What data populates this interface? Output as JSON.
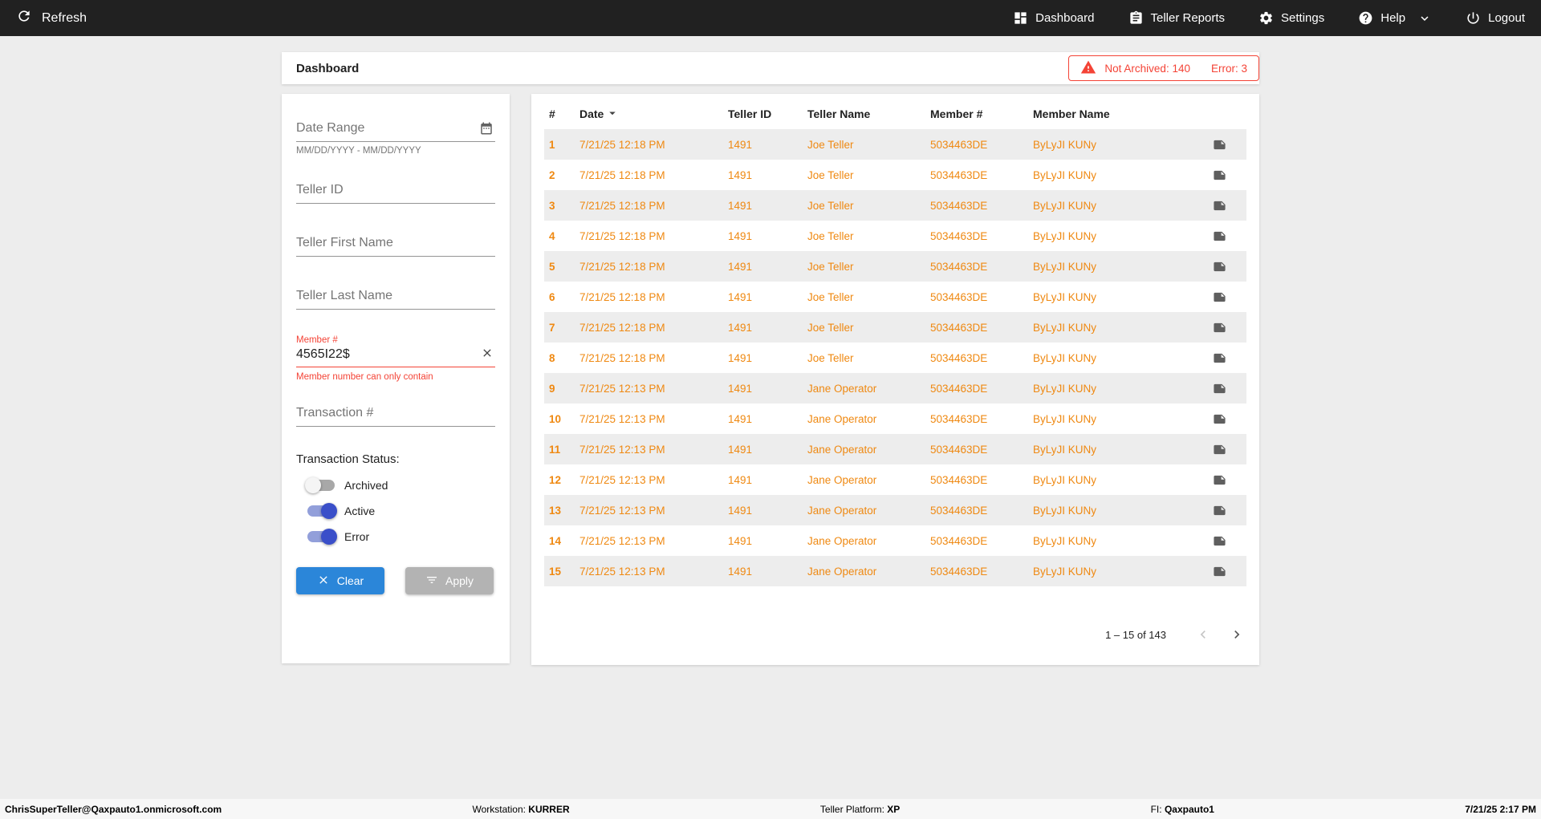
{
  "topbar": {
    "refresh_label": "Refresh",
    "nav": [
      {
        "label": "Dashboard"
      },
      {
        "label": "Teller Reports"
      },
      {
        "label": "Settings"
      },
      {
        "label": "Help"
      },
      {
        "label": "Logout"
      }
    ]
  },
  "header": {
    "title": "Dashboard",
    "alert": {
      "not_archived": "Not Archived: 140",
      "error": "Error: 3"
    }
  },
  "filters": {
    "date_range": {
      "placeholder": "Date Range",
      "helper": "MM/DD/YYYY - MM/DD/YYYY"
    },
    "teller_id": {
      "placeholder": "Teller ID"
    },
    "teller_first_name": {
      "placeholder": "Teller First Name"
    },
    "teller_last_name": {
      "placeholder": "Teller Last Name"
    },
    "member_number": {
      "label": "Member #",
      "value": "4565I22$",
      "error": "Member number can only contain"
    },
    "transaction_number": {
      "placeholder": "Transaction #"
    },
    "status": {
      "label": "Transaction Status:",
      "toggles": [
        {
          "label": "Archived",
          "on": false
        },
        {
          "label": "Active",
          "on": true
        },
        {
          "label": "Error",
          "on": true
        }
      ]
    },
    "clear_label": "Clear",
    "apply_label": "Apply"
  },
  "table": {
    "columns": [
      "#",
      "Date",
      "Teller ID",
      "Teller Name",
      "Member #",
      "Member Name"
    ],
    "rows": [
      {
        "num": "1",
        "date": "7/21/25 12:18 PM",
        "teller_id": "1491",
        "teller_name": "Joe Teller",
        "member_num": "5034463DE",
        "member_name": "ByLyJI KUNy"
      },
      {
        "num": "2",
        "date": "7/21/25 12:18 PM",
        "teller_id": "1491",
        "teller_name": "Joe Teller",
        "member_num": "5034463DE",
        "member_name": "ByLyJI KUNy"
      },
      {
        "num": "3",
        "date": "7/21/25 12:18 PM",
        "teller_id": "1491",
        "teller_name": "Joe Teller",
        "member_num": "5034463DE",
        "member_name": "ByLyJI KUNy"
      },
      {
        "num": "4",
        "date": "7/21/25 12:18 PM",
        "teller_id": "1491",
        "teller_name": "Joe Teller",
        "member_num": "5034463DE",
        "member_name": "ByLyJI KUNy"
      },
      {
        "num": "5",
        "date": "7/21/25 12:18 PM",
        "teller_id": "1491",
        "teller_name": "Joe Teller",
        "member_num": "5034463DE",
        "member_name": "ByLyJI KUNy"
      },
      {
        "num": "6",
        "date": "7/21/25 12:18 PM",
        "teller_id": "1491",
        "teller_name": "Joe Teller",
        "member_num": "5034463DE",
        "member_name": "ByLyJI KUNy"
      },
      {
        "num": "7",
        "date": "7/21/25 12:18 PM",
        "teller_id": "1491",
        "teller_name": "Joe Teller",
        "member_num": "5034463DE",
        "member_name": "ByLyJI KUNy"
      },
      {
        "num": "8",
        "date": "7/21/25 12:18 PM",
        "teller_id": "1491",
        "teller_name": "Joe Teller",
        "member_num": "5034463DE",
        "member_name": "ByLyJI KUNy"
      },
      {
        "num": "9",
        "date": "7/21/25 12:13 PM",
        "teller_id": "1491",
        "teller_name": "Jane Operator",
        "member_num": "5034463DE",
        "member_name": "ByLyJI KUNy"
      },
      {
        "num": "10",
        "date": "7/21/25 12:13 PM",
        "teller_id": "1491",
        "teller_name": "Jane Operator",
        "member_num": "5034463DE",
        "member_name": "ByLyJI KUNy"
      },
      {
        "num": "11",
        "date": "7/21/25 12:13 PM",
        "teller_id": "1491",
        "teller_name": "Jane Operator",
        "member_num": "5034463DE",
        "member_name": "ByLyJI KUNy"
      },
      {
        "num": "12",
        "date": "7/21/25 12:13 PM",
        "teller_id": "1491",
        "teller_name": "Jane Operator",
        "member_num": "5034463DE",
        "member_name": "ByLyJI KUNy"
      },
      {
        "num": "13",
        "date": "7/21/25 12:13 PM",
        "teller_id": "1491",
        "teller_name": "Jane Operator",
        "member_num": "5034463DE",
        "member_name": "ByLyJI KUNy"
      },
      {
        "num": "14",
        "date": "7/21/25 12:13 PM",
        "teller_id": "1491",
        "teller_name": "Jane Operator",
        "member_num": "5034463DE",
        "member_name": "ByLyJI KUNy"
      },
      {
        "num": "15",
        "date": "7/21/25 12:13 PM",
        "teller_id": "1491",
        "teller_name": "Jane Operator",
        "member_num": "5034463DE",
        "member_name": "ByLyJI KUNy"
      }
    ],
    "pagination": {
      "range": "1 – 15 of 143"
    }
  },
  "footer": {
    "user": "ChrisSuperTeller@Qaxpauto1.onmicrosoft.com",
    "workstation_label": "Workstation:",
    "workstation_value": "KURRER",
    "platform_label": "Teller Platform:",
    "platform_value": "XP",
    "fi_label": "FI:",
    "fi_value": "Qaxpauto1",
    "datetime": "7/21/25 2:17 PM"
  },
  "colors": {
    "topbar_bg": "#212121",
    "accent_orange": "#EF8912",
    "error_red": "#F44336",
    "clear_button_blue": "#2B86D9",
    "toggle_on_blue": "#3A4FC9",
    "apply_disabled_gray": "#B3B3B3"
  }
}
